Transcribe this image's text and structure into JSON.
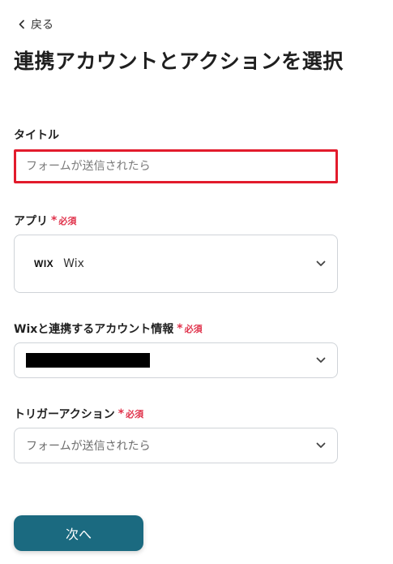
{
  "header": {
    "back_label": "戻る",
    "title": "連携アカウントとアクションを選択"
  },
  "form": {
    "title_field": {
      "label": "タイトル",
      "value": "",
      "placeholder": "フォームが送信されたら"
    },
    "app_field": {
      "label": "アプリ",
      "required_label": "必須",
      "logo_text": "WIX",
      "selected": "Wix"
    },
    "account_field": {
      "label": "Wixと連携するアカウント情報",
      "required_label": "必須",
      "selected": ""
    },
    "trigger_field": {
      "label": "トリガーアクション",
      "required_label": "必須",
      "selected": "フォームが送信されたら"
    }
  },
  "actions": {
    "next_label": "次へ"
  },
  "icons": {
    "back": "chevron-left-icon",
    "dropdown": "chevron-down-icon",
    "required": "asterisk-icon"
  },
  "colors": {
    "accent": "#1b6a80",
    "required": "#e0324b",
    "highlight_border": "#e21b2c"
  }
}
